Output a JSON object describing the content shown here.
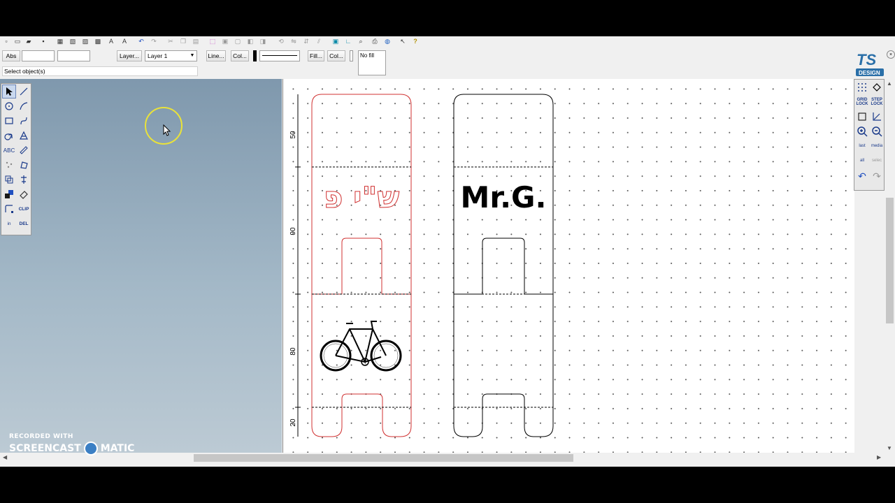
{
  "toolbar": {
    "abs_label": "Abs",
    "layer_button": "Layer...",
    "layer_select": "Layer 1",
    "line_button": "Line...",
    "line_color_button": "Col...",
    "fill_button": "Fill...",
    "fill_color_button": "Col...",
    "fill_preview": "No fill"
  },
  "status": "Select object(s)",
  "logo": {
    "text": "TS",
    "subtitle": "DESIGN"
  },
  "tools_left": [
    {
      "name": "select-arrow-icon"
    },
    {
      "name": "line-tool-icon"
    },
    {
      "name": "circle-tool-icon"
    },
    {
      "name": "arc-tool-icon"
    },
    {
      "name": "rectangle-tool-icon"
    },
    {
      "name": "curve-tool-icon"
    },
    {
      "name": "spiral-tool-icon"
    },
    {
      "name": "shape-tool-icon"
    },
    {
      "name": "text-tool-icon",
      "label": "ABC"
    },
    {
      "name": "measure-tool-icon"
    },
    {
      "name": "points-tool-icon"
    },
    {
      "name": "transform-tool-icon"
    },
    {
      "name": "group-tool-icon"
    },
    {
      "name": "align-tool-icon"
    },
    {
      "name": "color-tool-icon"
    },
    {
      "name": "eraser-tool-icon"
    },
    {
      "name": "node-tool-icon"
    },
    {
      "name": "clip-tool-icon",
      "label": "CLIP"
    },
    {
      "name": "insert-tool-icon",
      "label": "in"
    },
    {
      "name": "delete-tool-icon",
      "label": "DEL"
    }
  ],
  "tools_right": [
    {
      "name": "grid-icon"
    },
    {
      "name": "fill-bucket-icon"
    },
    {
      "name": "grid-lock-icon",
      "label": "GRID LOCK"
    },
    {
      "name": "step-lock-icon",
      "label": "STEP LOCK"
    },
    {
      "name": "frame-icon"
    },
    {
      "name": "axis-icon"
    },
    {
      "name": "zoom-in-icon"
    },
    {
      "name": "zoom-out-icon"
    },
    {
      "name": "zoom-last-icon",
      "label": "last"
    },
    {
      "name": "zoom-media-icon",
      "label": "media"
    },
    {
      "name": "zoom-all-icon",
      "label": "all"
    },
    {
      "name": "zoom-selection-icon",
      "label": "selec"
    },
    {
      "name": "undo-icon"
    },
    {
      "name": "redo-icon"
    }
  ],
  "drawing": {
    "dimensions": [
      "50",
      "90",
      "80",
      "20"
    ],
    "left_text": "ש\"י פ",
    "right_text": "Mr.G."
  },
  "watermark": {
    "recorded": "RECORDED WITH",
    "brand_left": "SCREENCAST",
    "brand_right": "MATIC"
  },
  "colors": {
    "outline_left": "#d03030",
    "outline_right": "#000000",
    "canvas_bg": "#ffffff",
    "panel_bg": "#8fa6b8"
  }
}
